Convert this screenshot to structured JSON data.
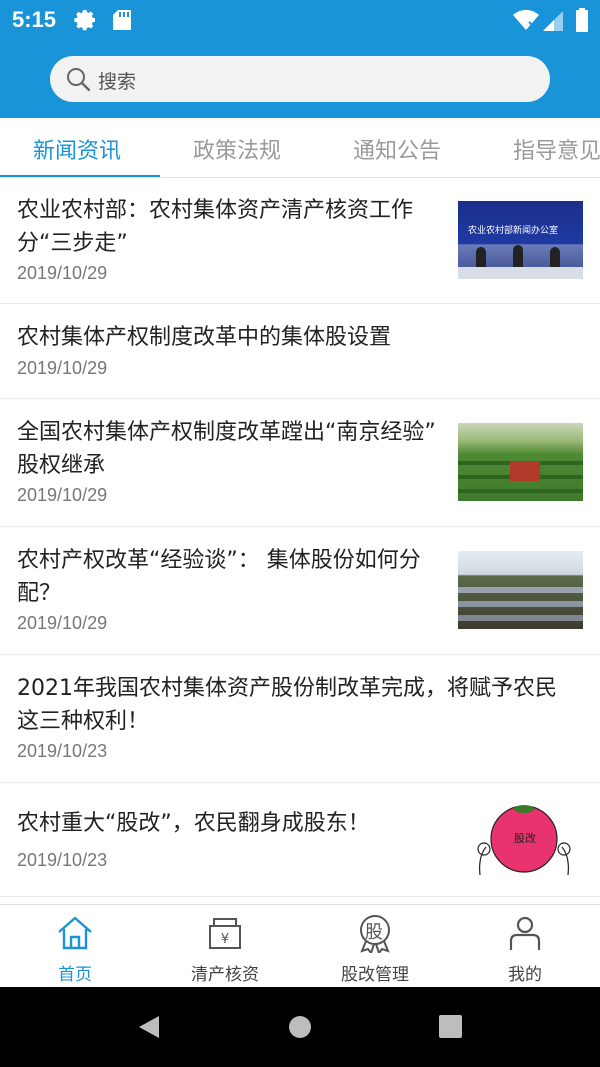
{
  "status_bar": {
    "time": "5:15",
    "icons": [
      "gear-icon",
      "sd-card-icon",
      "wifi-icon",
      "signal-icon",
      "battery-icon"
    ]
  },
  "search": {
    "placeholder": "搜索"
  },
  "tabs": [
    {
      "label": "新闻资讯",
      "active": true
    },
    {
      "label": "政策法规",
      "active": false
    },
    {
      "label": "通知公告",
      "active": false
    },
    {
      "label": "指导意见",
      "active": false
    }
  ],
  "news": [
    {
      "title_line1": "农业农村部：农村集体资产清产核资工作",
      "title_line2": "分“三步走”",
      "date": "2019/10/29",
      "thumb": "press-conference-image",
      "thumb_text": "农业农村部新闻办公室"
    },
    {
      "title_line1": "农村集体产权制度改革中的集体股设置",
      "title_line2": "",
      "date": "2019/10/29",
      "thumb": ""
    },
    {
      "title_line1": "全国农村集体产权制度改革蹚出“南京经验”",
      "title_line2": "股权继承",
      "date": "2019/10/29",
      "thumb": "tea-field-image"
    },
    {
      "title_line1": "农村产权改革“经验谈”： 集体股份如何分",
      "title_line2": "配？",
      "date": "2019/10/29",
      "thumb": "greenhouse-field-image"
    },
    {
      "title_line1": "2021年我国农村集体资产股份制改革完成，将赋予农民",
      "title_line2": "这三种权利！",
      "date": "2019/10/23",
      "thumb": ""
    },
    {
      "title_line1": "农村重大“股改”，农民翻身成股东！",
      "title_line2": "",
      "date": "2019/10/23",
      "thumb": "share-reform-cartoon",
      "thumb_text": "股改"
    }
  ],
  "bottom_nav": [
    {
      "label": "首页",
      "icon": "home-icon",
      "active": true
    },
    {
      "label": "清产核资",
      "icon": "asset-box-icon",
      "active": false
    },
    {
      "label": "股改管理",
      "icon": "share-badge-icon",
      "active": false,
      "icon_text": "股"
    },
    {
      "label": "我的",
      "icon": "profile-icon",
      "active": false
    }
  ],
  "colors": {
    "primary": "#1a94d8",
    "tab_inactive": "#9a9a9a",
    "text": "#222222",
    "date": "#777777"
  }
}
